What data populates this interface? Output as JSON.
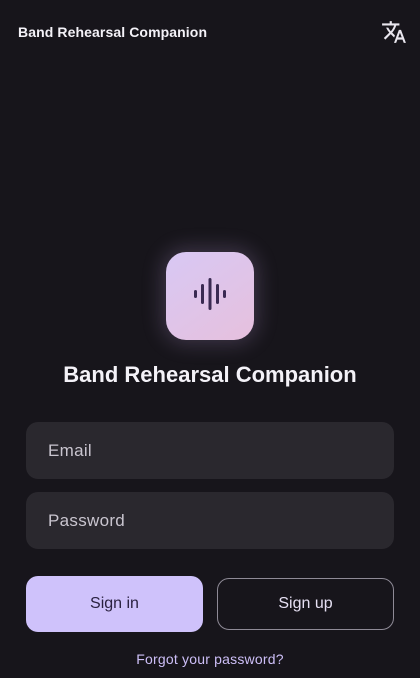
{
  "header": {
    "app_title": "Band Rehearsal Companion",
    "translate_icon": "translate-icon"
  },
  "logo": {
    "icon": "audio-waveform-icon",
    "gradient_start": "#d8c8f4",
    "gradient_end": "#e6c0dd",
    "glyph_color": "#3a2a52"
  },
  "main": {
    "heading": "Band Rehearsal Companion"
  },
  "form": {
    "email": {
      "value": "",
      "placeholder": "Email"
    },
    "password": {
      "value": "",
      "placeholder": "Password"
    },
    "sign_in_label": "Sign in",
    "sign_up_label": "Sign up",
    "forgot_label": "Forgot your password?"
  },
  "colors": {
    "background": "#17151b",
    "field_background": "#2a282e",
    "primary": "#cfc2fb",
    "link": "#cdbff7"
  }
}
